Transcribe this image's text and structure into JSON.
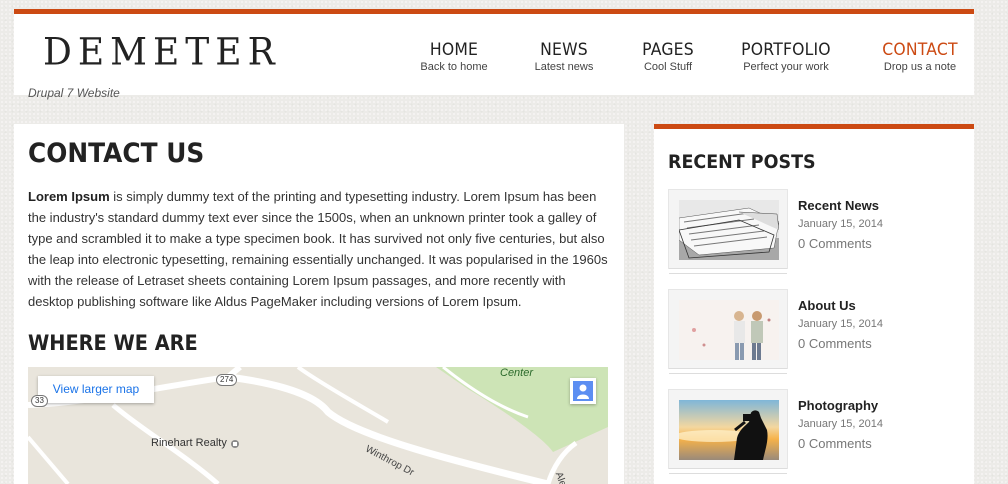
{
  "site": {
    "logo": "DEMETER",
    "tagline": "Drupal 7 Website"
  },
  "nav": [
    {
      "title": "HOME",
      "sub": "Back to home",
      "active": false
    },
    {
      "title": "NEWS",
      "sub": "Latest news",
      "active": false
    },
    {
      "title": "PAGES",
      "sub": "Cool Stuff",
      "active": false
    },
    {
      "title": "PORTFOLIO",
      "sub": "Perfect your work",
      "active": false
    },
    {
      "title": "CONTACT",
      "sub": "Drop us a note",
      "active": true
    }
  ],
  "main": {
    "title": "CONTACT US",
    "intro_bold": "Lorem Ipsum",
    "intro_text": " is simply dummy text of the printing and typesetting industry. Lorem Ipsum has been the industry's standard dummy text ever since the 1500s, when an unknown printer took a galley of type and scrambled it to make a type specimen book. It has survived not only five centuries, but also the leap into electronic typesetting, remaining essentially unchanged. It was popularised in the 1960s with the release of Letraset sheets containing Lorem Ipsum passages, and more recently with desktop publishing software like Aldus PageMaker including versions of Lorem Ipsum.",
    "section_title": "WHERE WE ARE"
  },
  "map": {
    "larger_map_label": "View larger map",
    "place_label": "Rinehart Realty",
    "road_label": "Winthrop Dr",
    "area_label": "Center",
    "route_274": "274",
    "route_partial": "33",
    "edge_label": "Ale"
  },
  "sidebar": {
    "title": "RECENT POSTS",
    "posts": [
      {
        "title": "Recent News",
        "date": "January 15, 2014",
        "comments": "0 Comments"
      },
      {
        "title": "About Us",
        "date": "January 15, 2014",
        "comments": "0 Comments"
      },
      {
        "title": "Photography",
        "date": "January 15, 2014",
        "comments": "0 Comments"
      }
    ]
  },
  "colors": {
    "accent": "#cc4a13",
    "link": "#1a73e8"
  },
  "icons": [
    "pegman-icon",
    "place-marker-icon"
  ]
}
